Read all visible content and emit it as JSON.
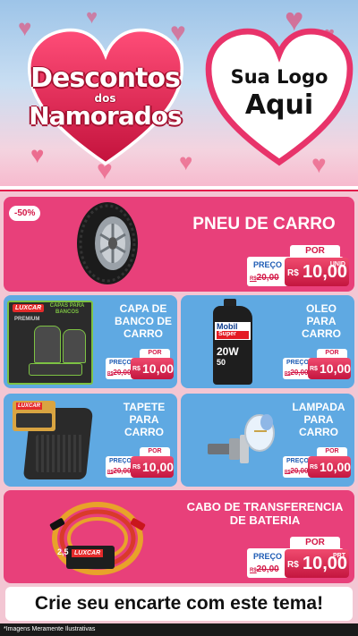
{
  "header": {
    "title_line1": "Descontos",
    "title_line2": "dos",
    "title_line3": "Namorados",
    "logo_line1": "Sua Logo",
    "logo_line2": "Aqui"
  },
  "products": [
    {
      "name": "PNEU DE CARRO",
      "discount": "-50%",
      "por_label": "POR",
      "preco_label": "PREÇO",
      "old_prefix": "R$",
      "old_price": "20,00",
      "currency": "R$",
      "price": "10,00",
      "unit": "UNID"
    },
    {
      "name_lines": [
        "CAPA DE",
        "BANCO DE",
        "CARRO"
      ],
      "por_label": "POR",
      "preco_label": "PREÇO",
      "old_prefix": "R$",
      "old_price": "20,00",
      "currency": "R$",
      "price": "10,00"
    },
    {
      "name_lines": [
        "OLEO",
        "PARA",
        "CARRO"
      ],
      "por_label": "POR",
      "preco_label": "PREÇO",
      "old_prefix": "R$",
      "old_price": "20,00",
      "currency": "R$",
      "price": "10,00"
    },
    {
      "name_lines": [
        "TAPETE",
        "PARA",
        "CARRO"
      ],
      "por_label": "POR",
      "preco_label": "PREÇO",
      "old_prefix": "R$",
      "old_price": "20,00",
      "currency": "R$",
      "price": "10,00"
    },
    {
      "name_lines": [
        "LAMPADA",
        "PARA",
        "CARRO"
      ],
      "por_label": "POR",
      "preco_label": "PREÇO",
      "old_prefix": "R$",
      "old_price": "20,00",
      "currency": "R$",
      "price": "10,00"
    },
    {
      "name_lines": [
        "CABO DE TRANSFERENCIA",
        "DE BATERIA"
      ],
      "por_label": "POR",
      "preco_label": "PREÇO",
      "old_prefix": "R$",
      "old_price": "20,00",
      "currency": "R$",
      "price": "10,00",
      "unit": "PRT"
    }
  ],
  "product_images": {
    "tire": "tire-image",
    "seat_cover": "seat-cover-image",
    "oil": "oil-bottle-image",
    "oil_brand": "Mobil",
    "oil_sub": "Super",
    "oil_grade": "20W",
    "oil_grade2": "50",
    "mat": "car-mat-image",
    "lamp": "headlight-bulb-image",
    "cable": "jumper-cable-image",
    "seat_brand": "LUXCAR",
    "seat_box_title": "CAPAS PARA BANCOS",
    "seat_premium": "PREMIUM",
    "cable_brand": "LUXCAR",
    "cable_spec": "2,5",
    "mat_brand": "LUXCAR"
  },
  "footer": {
    "cta": "Crie seu encarte com este tema!",
    "disclaimer": "*Imagens Meramente Ilustrativas"
  },
  "colors": {
    "pink": "#e8407a",
    "blue": "#5fa9e2",
    "red": "#d31847",
    "price_blue": "#1c5bb4"
  }
}
